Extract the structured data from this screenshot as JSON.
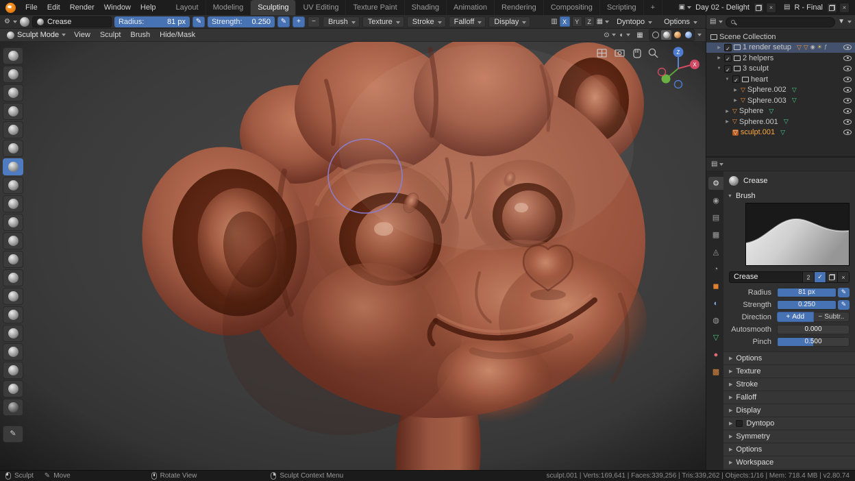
{
  "colors": {
    "accent": "#4772b3",
    "clay": "#9a5340",
    "active_object_text": "#ffa83c",
    "brush_cursor": "#8b7fd4"
  },
  "icons": {
    "gear": "⚙",
    "pen": "✎",
    "plus": "+",
    "minus": "−",
    "close": "×",
    "check": "✓",
    "collapsed_arrow": "▶",
    "expanded_arrow": "▼",
    "mesh_triangle": "▽",
    "camera": "◉",
    "light": "☀",
    "fcurve": "ƒ",
    "scene": "▣",
    "view_layer": "▤",
    "grid_a": "▦",
    "grid_b": "▥",
    "pivot": "⊙",
    "overlay": "◐",
    "funnel": "▼",
    "tabs": {
      "tool": "⚙",
      "render": "◉",
      "output": "▤",
      "view_layer": "▦",
      "scene": "◬",
      "world": "◔",
      "object": "◼",
      "modifiers": "◐",
      "physics": "◍",
      "data": "▽",
      "material": "●",
      "texture": "▩"
    }
  },
  "topbar": {
    "menus": [
      "File",
      "Edit",
      "Render",
      "Window",
      "Help"
    ],
    "workspaces": [
      "Layout",
      "Modeling",
      "Sculpting",
      "UV Editing",
      "Texture Paint",
      "Shading",
      "Animation",
      "Rendering",
      "Compositing",
      "Scripting"
    ],
    "active_workspace": "Sculpting",
    "new_workspace": "+",
    "scene_name": "Day 02 - Delight",
    "view_layer_name": "R - Final"
  },
  "tool_settings": {
    "brush_name": "Crease",
    "radius_label": "Radius:",
    "radius_value": "81 px",
    "strength_label": "Strength:",
    "strength_value": "0.250",
    "dropdowns": [
      "Brush",
      "Texture",
      "Stroke",
      "Falloff",
      "Display"
    ],
    "mirror_label": [
      "X",
      "Y",
      "Z"
    ],
    "dyntopo_label": "Dyntopo",
    "options_label": "Options"
  },
  "viewport": {
    "mode_label": "Sculpt Mode",
    "menus": [
      "View",
      "Sculpt",
      "Brush",
      "Hide/Mask"
    ],
    "gizmo": {
      "z_label": "Z",
      "x_label": "X"
    }
  },
  "outliner": {
    "rows": [
      {
        "label": "Scene Collection"
      },
      {
        "label": "1 render setup"
      },
      {
        "label": "2 helpers"
      },
      {
        "label": "3 sculpt"
      },
      {
        "label": "heart"
      },
      {
        "label": "Sphere.002"
      },
      {
        "label": "Sphere.003"
      },
      {
        "label": "Sphere"
      },
      {
        "label": "Sphere.001"
      },
      {
        "label": "sculpt.001"
      }
    ]
  },
  "properties": {
    "active_brush_label": "Crease",
    "brush_panel_label": "Brush",
    "name_field_value": "Crease",
    "users_count": "2",
    "radius_label": "Radius",
    "radius_value": "81 px",
    "strength_label": "Strength",
    "strength_value": "0.250",
    "direction_label": "Direction",
    "direction_add": "Add",
    "direction_subtract": "Subtr..",
    "autosmooth_label": "Autosmooth",
    "autosmooth_value": "0.000",
    "pinch_label": "Pinch",
    "pinch_value": "0.500",
    "sections": [
      "Options",
      "Texture",
      "Stroke",
      "Falloff",
      "Display",
      "Dyntopo",
      "Symmetry",
      "Options",
      "Workspace"
    ]
  },
  "statusbar": {
    "hints": [
      "Sculpt",
      "Move",
      "Rotate View",
      "Sculpt Context Menu"
    ],
    "stats": "sculpt.001 | Verts:169,641 | Faces:339,256 | Tris:339,262 | Objects:1/16 | Mem: 718.4 MB | v2.80.74"
  }
}
